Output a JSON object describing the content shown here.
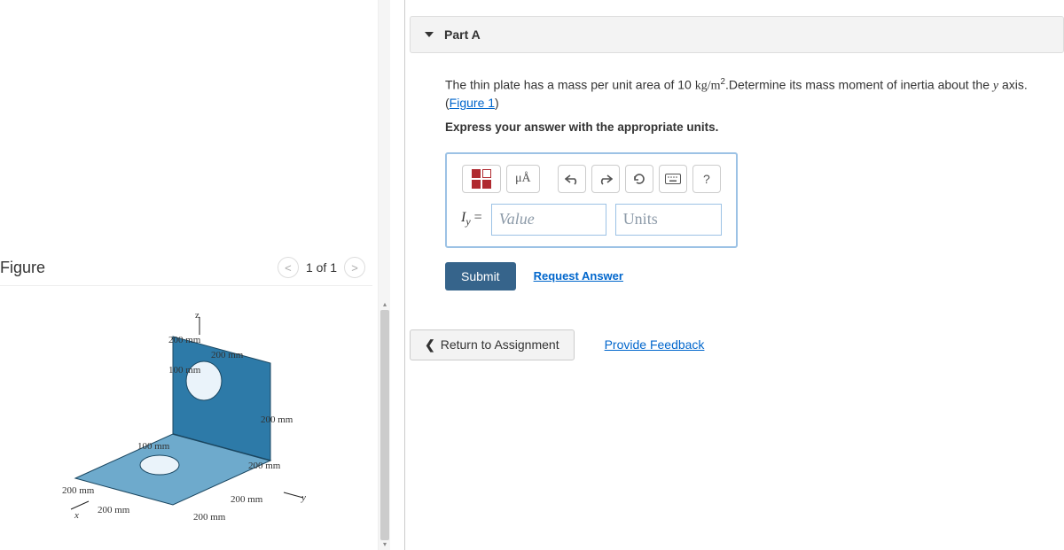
{
  "figure": {
    "title": "Figure",
    "pager": {
      "prev": "<",
      "label": "1 of 1",
      "next": ">"
    },
    "dims": {
      "z": "z",
      "top200a": "200 mm",
      "top200b": "200 mm",
      "top100": "100 mm",
      "right200a": "200 mm",
      "right200b": "200 mm",
      "left200": "200 mm",
      "bot200a": "200 mm",
      "bot200b": "200 mm",
      "bot200c": "200 mm",
      "hole100": "100 mm",
      "x": "x",
      "y": "y"
    }
  },
  "part": {
    "label": "Part A",
    "text_prefix": "The thin plate has a mass per unit area of 10 ",
    "units_inline": "kg/m",
    "exp": "2",
    "text_suffix": ".Determine its mass moment of inertia about the ",
    "axis": "y",
    "text_end": " axis.",
    "figure_link": "Figure 1",
    "note": "Express your answer with the appropriate units.",
    "mu_label": "μÅ",
    "help_label": "?",
    "eq_var": "I",
    "eq_sub": "y",
    "eq_eq": " = ",
    "value_ph": "Value",
    "units_ph": "Units",
    "submit": "Submit",
    "request": "Request Answer"
  },
  "footer": {
    "return": "Return to Assignment",
    "feedback": "Provide Feedback"
  }
}
